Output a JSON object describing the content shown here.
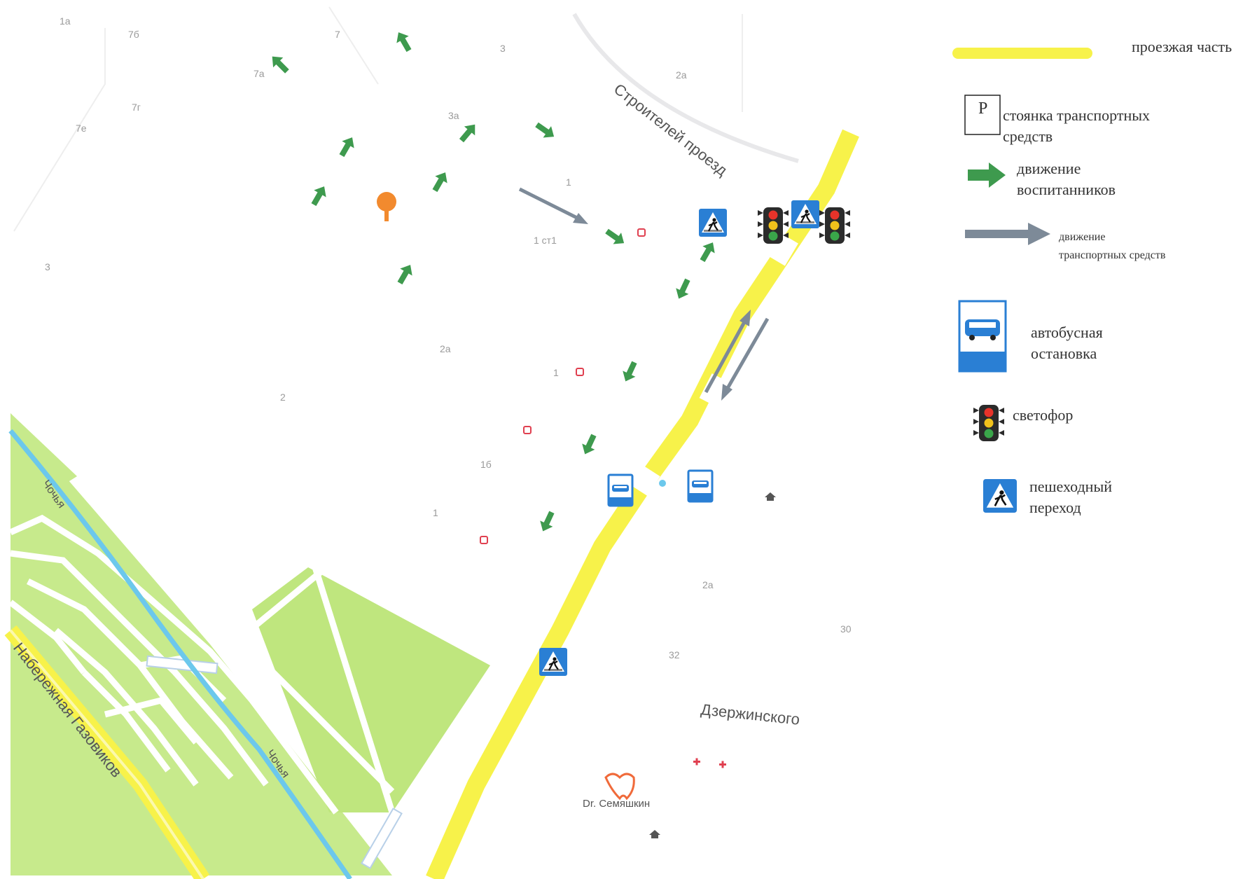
{
  "street_labels": {
    "stroiteley": "Строителей проезд",
    "naberezhnaya": "Набережная Газовиков",
    "dzerzhinskogo": "Дзержинского",
    "river_1": "Чочья",
    "river_2": "Чочья"
  },
  "poi": {
    "dentist": "Dr. Семяшкин"
  },
  "house_numbers": [
    "1а",
    "7б",
    "7",
    "3",
    "7а",
    "7г",
    "7е",
    "3а",
    "2а",
    "1",
    "1 ст1",
    "3",
    "2а",
    "1",
    "2",
    "1б",
    "1",
    "2а",
    "30",
    "32"
  ],
  "legend": {
    "roadway": "проезжая часть",
    "parking_letter": "P",
    "parking_line1": "стоянка транспортных",
    "parking_line2": "средств",
    "pupils_line1": "движение",
    "pupils_line2": "воспитанников",
    "vehicles_line1": "движение",
    "vehicles_line2": "транспортных средств",
    "bus_line1": "автобусная",
    "bus_line2": "остановка",
    "traffic_light": "светофор",
    "crossing_line1": "пешеходный",
    "crossing_line2": "переход"
  },
  "colors": {
    "road_yellow": "#f7f24a",
    "park_green": "#c4e98a",
    "river_blue": "#6cc8ec",
    "pupil_arrow": "#3e9a4e",
    "vehicle_arrow": "#7d8a98",
    "sign_blue": "#2a7fd4"
  }
}
